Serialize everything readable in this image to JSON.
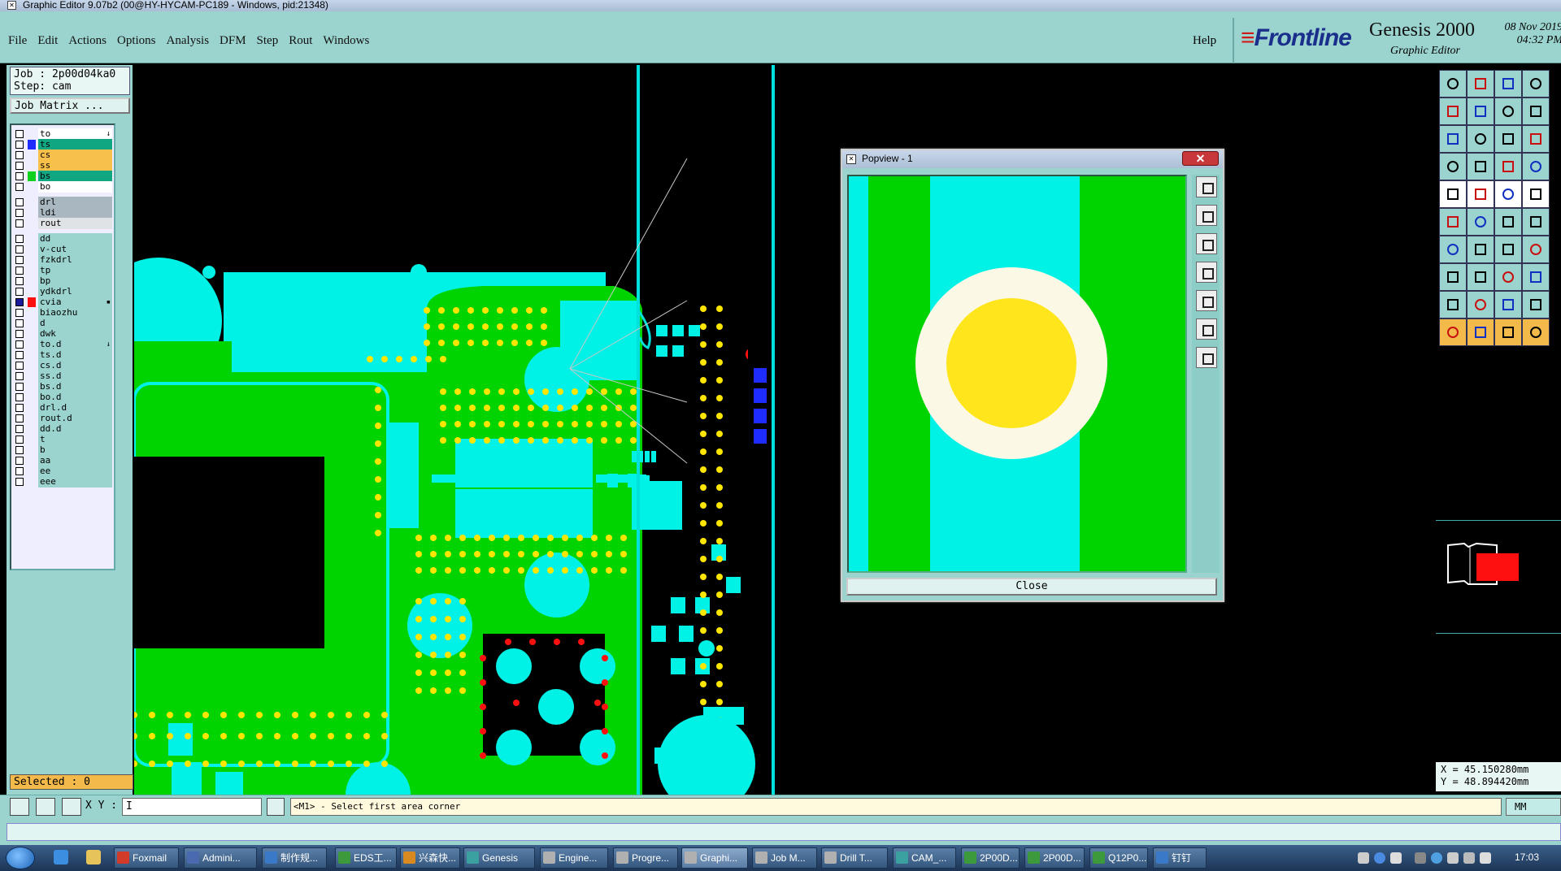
{
  "window": {
    "title": "Graphic Editor 9.07b2 (00@HY-HYCAM-PC189 - Windows, pid:21348)",
    "icon_name": "window-app-icon"
  },
  "menu": {
    "items": [
      "File",
      "Edit",
      "Actions",
      "Options",
      "Analysis",
      "DFM",
      "Step",
      "Rout",
      "Windows"
    ],
    "help": "Help"
  },
  "brand": {
    "logo": "Frontline",
    "product": "Genesis 2000",
    "subtitle": "Graphic Editor",
    "date": "08 Nov 2019",
    "time": "04:32 PM"
  },
  "job": {
    "job_label": "Job : 2p00d04ka0",
    "step_label": "Step: cam",
    "matrix_button": "Job Matrix ..."
  },
  "layers": [
    {
      "name": "to",
      "color": "#ffffff",
      "swatch": "",
      "marker": "↓"
    },
    {
      "name": "ts",
      "color": "#10a682",
      "swatch": "#1f2cff",
      "marker": ""
    },
    {
      "name": "cs",
      "color": "#f7c04a",
      "swatch": "",
      "marker": ""
    },
    {
      "name": "ss",
      "color": "#f7c04a",
      "swatch": "",
      "marker": ""
    },
    {
      "name": "bs",
      "color": "#10a682",
      "swatch": "#10d020",
      "marker": ""
    },
    {
      "name": "bo",
      "color": "#ffffff",
      "swatch": "",
      "marker": ""
    },
    {
      "name": "drl",
      "color": "#a9b7c0",
      "swatch": "",
      "marker": ""
    },
    {
      "name": "ldi",
      "color": "#a9b7c0",
      "swatch": "",
      "marker": ""
    },
    {
      "name": "rout",
      "color": "#dfe3e6",
      "swatch": "",
      "marker": ""
    },
    {
      "name": "dd",
      "color": "#9bd4cf",
      "swatch": "",
      "marker": ""
    },
    {
      "name": "v-cut",
      "color": "#9bd4cf",
      "swatch": "",
      "marker": ""
    },
    {
      "name": "fzkdrl",
      "color": "#9bd4cf",
      "swatch": "",
      "marker": ""
    },
    {
      "name": "tp",
      "color": "#9bd4cf",
      "swatch": "",
      "marker": ""
    },
    {
      "name": "bp",
      "color": "#9bd4cf",
      "swatch": "",
      "marker": ""
    },
    {
      "name": "ydkdrl",
      "color": "#9bd4cf",
      "swatch": "",
      "marker": ""
    },
    {
      "name": "cvia",
      "color": "#9bd4cf",
      "swatch": "#ff1010",
      "marker": "▪",
      "checked": true
    },
    {
      "name": "biaozhu",
      "color": "#9bd4cf",
      "swatch": "",
      "marker": ""
    },
    {
      "name": "d",
      "color": "#9bd4cf",
      "swatch": "",
      "marker": ""
    },
    {
      "name": "dwk",
      "color": "#9bd4cf",
      "swatch": "",
      "marker": ""
    },
    {
      "name": "to.d",
      "color": "#9bd4cf",
      "swatch": "",
      "marker": "↓"
    },
    {
      "name": "ts.d",
      "color": "#9bd4cf",
      "swatch": "",
      "marker": ""
    },
    {
      "name": "cs.d",
      "color": "#9bd4cf",
      "swatch": "",
      "marker": ""
    },
    {
      "name": "ss.d",
      "color": "#9bd4cf",
      "swatch": "",
      "marker": ""
    },
    {
      "name": "bs.d",
      "color": "#9bd4cf",
      "swatch": "",
      "marker": ""
    },
    {
      "name": "bo.d",
      "color": "#9bd4cf",
      "swatch": "",
      "marker": ""
    },
    {
      "name": "drl.d",
      "color": "#9bd4cf",
      "swatch": "",
      "marker": ""
    },
    {
      "name": "rout.d",
      "color": "#9bd4cf",
      "swatch": "",
      "marker": ""
    },
    {
      "name": "dd.d",
      "color": "#9bd4cf",
      "swatch": "",
      "marker": ""
    },
    {
      "name": "t",
      "color": "#9bd4cf",
      "swatch": "",
      "marker": ""
    },
    {
      "name": "b",
      "color": "#9bd4cf",
      "swatch": "",
      "marker": ""
    },
    {
      "name": "aa",
      "color": "#9bd4cf",
      "swatch": "",
      "marker": ""
    },
    {
      "name": "ee",
      "color": "#9bd4cf",
      "swatch": "",
      "marker": ""
    },
    {
      "name": "eee",
      "color": "#9bd4cf",
      "swatch": "",
      "marker": ""
    }
  ],
  "selected": "Selected : 0",
  "popview": {
    "title": "Popview - 1",
    "close_label": "Close",
    "close_x": "✕"
  },
  "coords": {
    "x": "X = 45.150280mm",
    "y": "Y = 48.894420mm"
  },
  "command": {
    "xy_label": "X Y :",
    "xy_value": "I",
    "status": "<M1> - Select first area corner",
    "unit": "MM"
  },
  "taskbar": {
    "tasks": [
      {
        "label": "Foxmail",
        "color": "#d23a2a"
      },
      {
        "label": "Admini...",
        "color": "#4a6ab0"
      },
      {
        "label": "制作规...",
        "color": "#3a78c8"
      },
      {
        "label": "EDS工...",
        "color": "#3c9a3c"
      },
      {
        "label": "兴森快...",
        "color": "#d88a20"
      },
      {
        "label": "Genesis",
        "color": "#3aa0a0"
      },
      {
        "label": "Engine...",
        "color": "#b0b0b0"
      },
      {
        "label": "Progre...",
        "color": "#b0b0b0"
      },
      {
        "label": "Graphi...",
        "color": "#b0b0b0",
        "active": true
      },
      {
        "label": "Job M...",
        "color": "#b0b0b0"
      },
      {
        "label": "Drill T...",
        "color": "#b0b0b0"
      },
      {
        "label": "CAM_...",
        "color": "#3aa0a0"
      },
      {
        "label": "2P00D...",
        "color": "#3c9a3c"
      },
      {
        "label": "2P00D...",
        "color": "#3c9a3c"
      },
      {
        "label": "Q12P0...",
        "color": "#3c9a3c"
      },
      {
        "label": "钉钉",
        "color": "#3a78c8"
      }
    ],
    "time": "17:03"
  }
}
